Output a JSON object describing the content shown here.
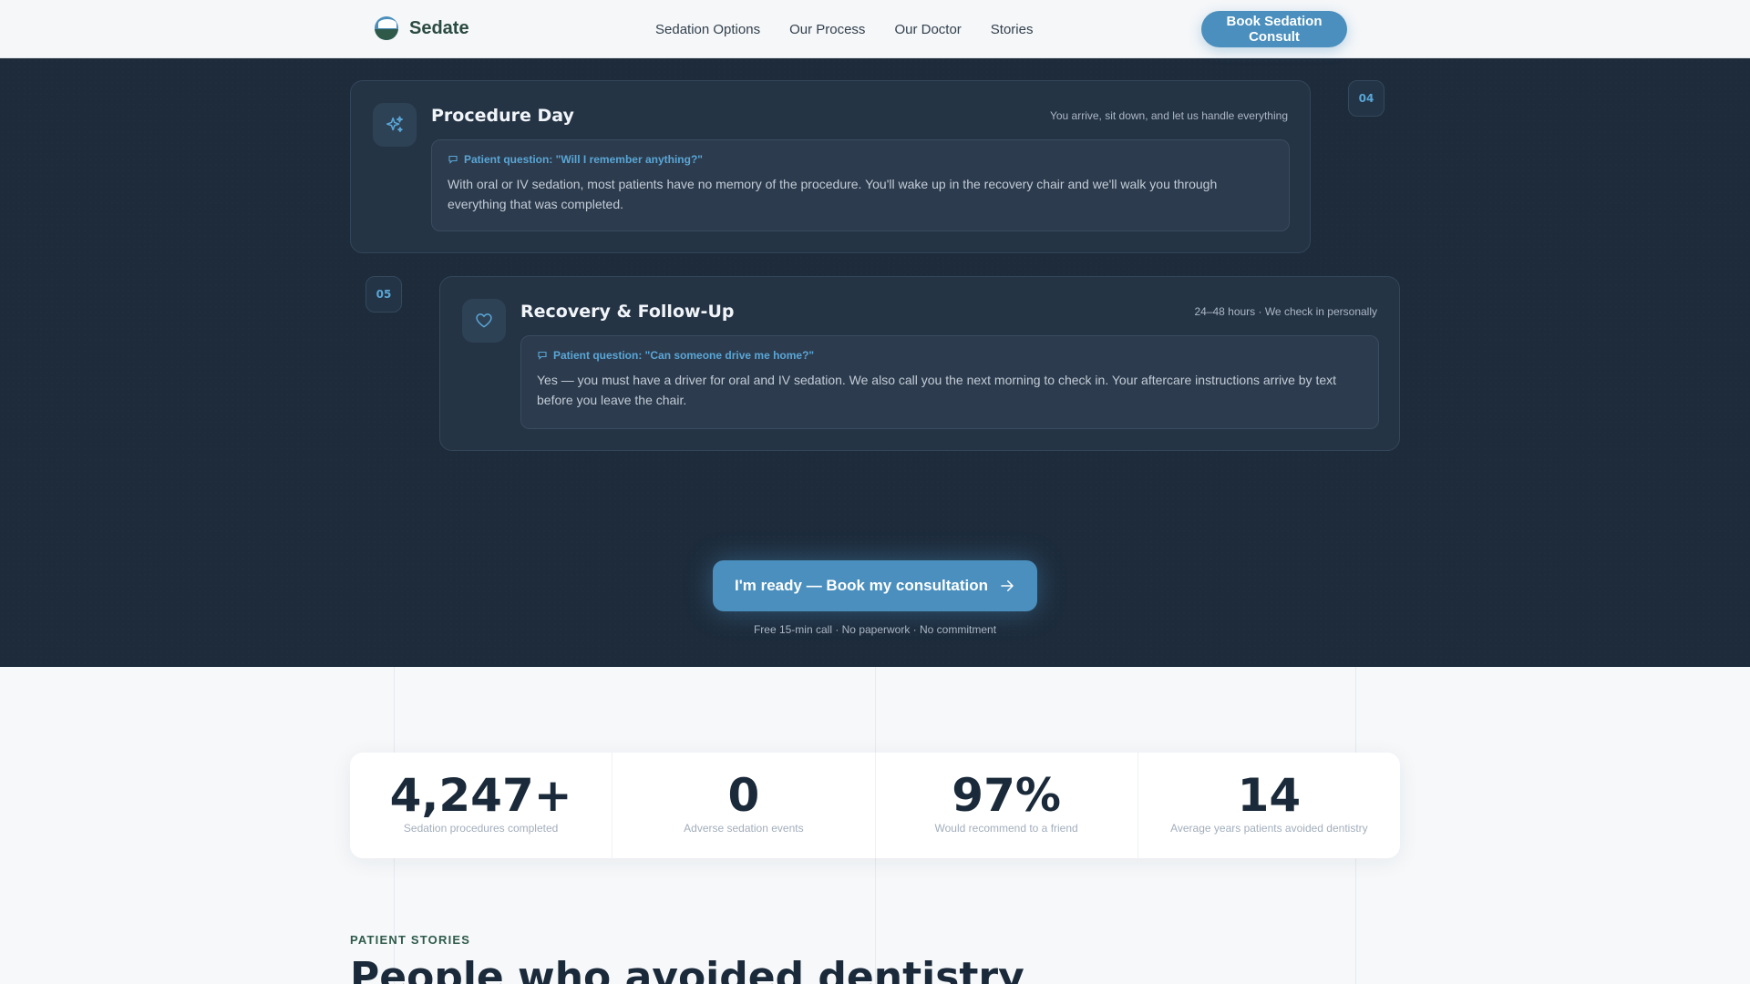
{
  "nav": {
    "brand": "Sedate",
    "links": [
      "Sedation Options",
      "Our Process",
      "Our Doctor",
      "Stories"
    ],
    "cta": "Book Sedation Consult"
  },
  "steps": [
    {
      "number": "04",
      "title": "Procedure Day",
      "meta": "You arrive, sit down, and let us handle everything",
      "icon": "sparkles-icon",
      "question": "Patient question: \"Will I remember anything?\"",
      "answer": "With oral or IV sedation, most patients have no memory of the procedure. You'll wake up in the recovery chair and we'll walk you through everything that was completed."
    },
    {
      "number": "05",
      "title": "Recovery & Follow-Up",
      "meta": "24–48 hours · We check in personally",
      "icon": "heart-icon",
      "question": "Patient question: \"Can someone drive me home?\"",
      "answer": "Yes — you must have a driver for oral and IV sedation. We also call you the next morning to check in. Your aftercare instructions arrive by text before you leave the chair."
    }
  ],
  "cta": {
    "label": "I'm ready — Book my consultation",
    "icon": "arrow-right-icon",
    "note": "Free 15-min call · No paperwork · No commitment"
  },
  "stats": [
    {
      "value": "4,247+",
      "label": "Sedation procedures completed"
    },
    {
      "value": "0",
      "label": "Adverse sedation events"
    },
    {
      "value": "97%",
      "label": "Would recommend to a friend"
    },
    {
      "value": "14",
      "label": "Average years patients avoided dentistry"
    }
  ],
  "stories": {
    "eyebrow": "PATIENT STORIES",
    "title": "People who avoided dentistry"
  },
  "colors": {
    "accent": "#4a8fbd",
    "dark_bg": "#1d2b3b",
    "brand_green": "#2f5a4a",
    "question": "#5aa6d6"
  }
}
